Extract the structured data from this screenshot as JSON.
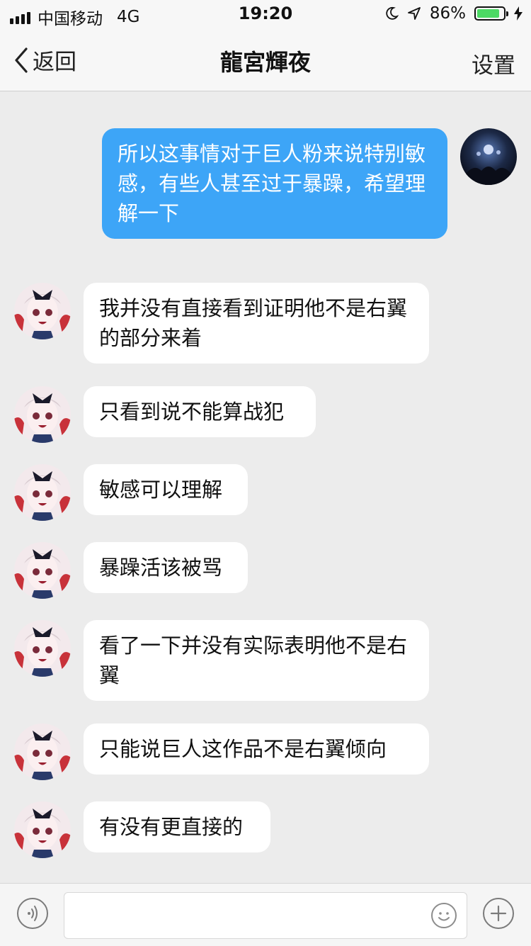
{
  "status_bar": {
    "carrier": "中国移动",
    "network": "4G",
    "time": "19:20",
    "battery_percent": "86%",
    "battery_level": 0.86
  },
  "nav": {
    "back_label": "返回",
    "title": "龍宮輝夜",
    "settings_label": "设置"
  },
  "messages": [
    {
      "side": "out",
      "text": "所以这事情对于巨人粉来说特别敏感，有些人甚至过于暴躁，希望理解一下"
    },
    {
      "side": "in",
      "text": "我并没有直接看到证明他不是右翼的部分来着"
    },
    {
      "side": "in",
      "text": "只看到说不能算战犯"
    },
    {
      "side": "in",
      "text": "敏感可以理解"
    },
    {
      "side": "in",
      "text": "暴躁活该被骂"
    },
    {
      "side": "in",
      "text": "看了一下并没有实际表明他不是右翼"
    },
    {
      "side": "in",
      "text": "只能说巨人这作品不是右翼倾向"
    },
    {
      "side": "in",
      "text": "有没有更直接的"
    }
  ],
  "input_bar": {
    "placeholder": "",
    "icons": [
      "voice-icon",
      "emoji-icon",
      "plus-icon"
    ]
  },
  "colors": {
    "outgoing_bubble": "#3da5f7",
    "incoming_bubble": "#ffffff",
    "background": "#ececec"
  }
}
